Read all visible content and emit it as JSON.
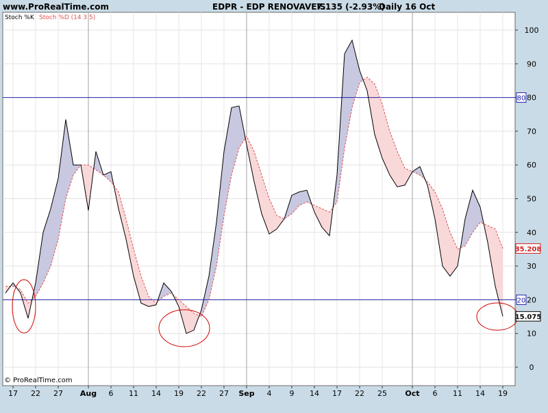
{
  "header": {
    "site": "www.ProRealTime.com",
    "symbol": "EDPR - EDP RENOVAVEIS",
    "price_change": "7.135 (-2.93%)",
    "period_date": "Daily  16 Oct"
  },
  "legend": {
    "k_label": "Stoch %K",
    "d_label": "Stoch %D (14 3 5)"
  },
  "footer": {
    "copyright": "© ProRealTime.com"
  },
  "colors": {
    "background": "#c9dbe6",
    "plot": "#ffffff",
    "k_line": "#000000",
    "d_line": "#e05050",
    "fill_k_above": "#c8c8e0",
    "fill_d_above": "#f8d8d8",
    "level_line": "#2222aa",
    "value_badge_d": "#cc2222"
  },
  "chart_data": {
    "type": "line",
    "title": "EDPR - EDP RENOVAVEIS",
    "ylim": [
      -5,
      103
    ],
    "y_ticks": [
      0,
      10,
      20,
      30,
      40,
      50,
      60,
      70,
      80,
      90,
      100
    ],
    "x_tick_labels": [
      {
        "label": "17",
        "i": 1,
        "bold": false
      },
      {
        "label": "22",
        "i": 4,
        "bold": false
      },
      {
        "label": "27",
        "i": 7,
        "bold": false
      },
      {
        "label": "Aug",
        "i": 11,
        "bold": true
      },
      {
        "label": "6",
        "i": 14,
        "bold": false
      },
      {
        "label": "11",
        "i": 17,
        "bold": false
      },
      {
        "label": "14",
        "i": 20,
        "bold": false
      },
      {
        "label": "19",
        "i": 23,
        "bold": false
      },
      {
        "label": "22",
        "i": 26,
        "bold": false
      },
      {
        "label": "27",
        "i": 29,
        "bold": false
      },
      {
        "label": "Sep",
        "i": 32,
        "bold": true
      },
      {
        "label": "4",
        "i": 35,
        "bold": false
      },
      {
        "label": "9",
        "i": 38,
        "bold": false
      },
      {
        "label": "14",
        "i": 41,
        "bold": false
      },
      {
        "label": "17",
        "i": 44,
        "bold": false
      },
      {
        "label": "22",
        "i": 47,
        "bold": false
      },
      {
        "label": "25",
        "i": 50,
        "bold": false
      },
      {
        "label": "Oct",
        "i": 54,
        "bold": true
      },
      {
        "label": "6",
        "i": 57,
        "bold": false
      },
      {
        "label": "11",
        "i": 60,
        "bold": false
      },
      {
        "label": "14",
        "i": 63,
        "bold": false
      },
      {
        "label": "19",
        "i": 66,
        "bold": false
      }
    ],
    "month_separators": [
      11,
      32,
      54
    ],
    "levels": [
      {
        "value": 80,
        "label": "80"
      },
      {
        "value": 20,
        "label": "20"
      }
    ],
    "value_badges": [
      {
        "value": 35.208,
        "label": "35.208",
        "series": "d"
      },
      {
        "value": 15.075,
        "label": "15.075",
        "series": "k"
      }
    ],
    "series": [
      {
        "name": "Stoch %K",
        "key": "k",
        "values": [
          22,
          25,
          22,
          14.5,
          25,
          40,
          47,
          56,
          73.5,
          60,
          60,
          46.5,
          64,
          57,
          58,
          47,
          38,
          27,
          19,
          18,
          18.5,
          25,
          22.5,
          18,
          10,
          11,
          17,
          27,
          43,
          64,
          77,
          77.5,
          66,
          55,
          45.5,
          39.5,
          41,
          44,
          51,
          52,
          52.5,
          46,
          41.5,
          39,
          57,
          93,
          97,
          88,
          82,
          69,
          62,
          57,
          53.5,
          54,
          58,
          59.5,
          54,
          44,
          30,
          27,
          30,
          44,
          52.5,
          47.5,
          37,
          24,
          15.075
        ]
      },
      {
        "name": "Stoch %D (14 3 5)",
        "key": "d",
        "values": [
          24,
          24,
          23,
          19,
          21,
          25,
          30,
          38,
          50,
          57,
          60,
          60,
          58.5,
          57,
          55,
          52,
          44,
          35,
          27,
          21,
          19,
          21,
          22,
          20,
          18,
          16,
          15,
          20,
          30,
          45,
          57,
          65,
          68.5,
          64,
          57,
          50,
          45,
          44,
          45.5,
          48,
          49,
          48,
          47,
          46,
          49,
          65,
          77,
          84.5,
          86,
          84,
          78,
          70,
          64,
          59,
          58,
          57,
          55,
          52,
          47,
          40,
          35,
          36,
          40,
          43,
          42,
          41,
          35.208
        ]
      }
    ]
  }
}
